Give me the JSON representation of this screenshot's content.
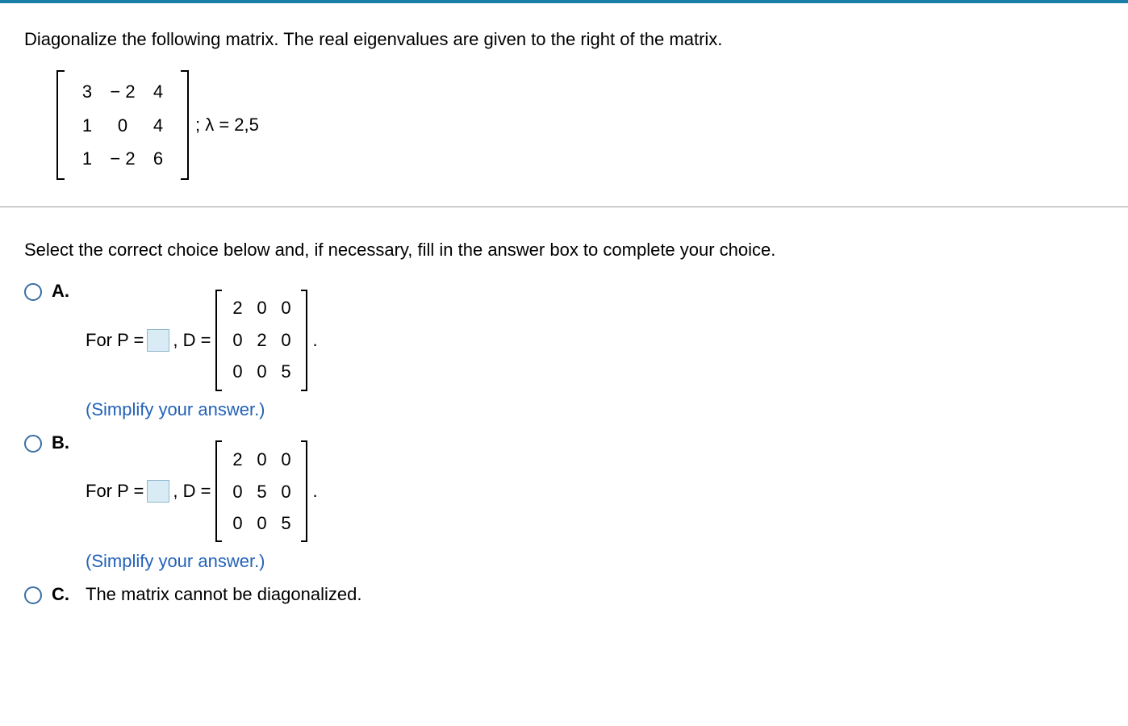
{
  "topBarColor": "#1a7fa8",
  "question": "Diagonalize the following matrix. The real eigenvalues are given to the right of the matrix.",
  "problemMatrix": {
    "rows": [
      [
        "3",
        "− 2",
        "4"
      ],
      [
        "1",
        "0",
        "4"
      ],
      [
        "1",
        "− 2",
        "6"
      ]
    ]
  },
  "eigenText": "; λ = 2,5",
  "instruction": "Select the correct choice below and, if necessary, fill in the answer box to complete your choice.",
  "choices": {
    "a": {
      "letter": "A.",
      "prefix": "For P =",
      "dprefix": ", D =",
      "dmatrix": {
        "rows": [
          [
            "2",
            "0",
            "0"
          ],
          [
            "0",
            "2",
            "0"
          ],
          [
            "0",
            "0",
            "5"
          ]
        ]
      },
      "period": ".",
      "simplify": "(Simplify your answer.)"
    },
    "b": {
      "letter": "B.",
      "prefix": "For P =",
      "dprefix": ", D =",
      "dmatrix": {
        "rows": [
          [
            "2",
            "0",
            "0"
          ],
          [
            "0",
            "5",
            "0"
          ],
          [
            "0",
            "0",
            "5"
          ]
        ]
      },
      "period": ".",
      "simplify": "(Simplify your answer.)"
    },
    "c": {
      "letter": "C.",
      "text": "The matrix cannot be diagonalized."
    }
  }
}
